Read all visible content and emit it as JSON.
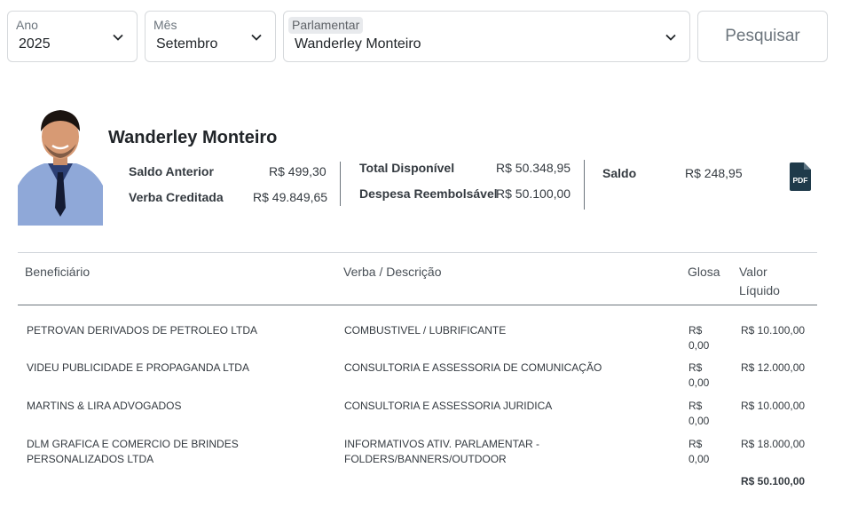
{
  "filters": {
    "ano": {
      "label": "Ano",
      "value": "2025"
    },
    "mes": {
      "label": "Mês",
      "value": "Setembro"
    },
    "parlamentar": {
      "label": "Parlamentar",
      "value": "Wanderley Monteiro"
    },
    "search_label": "Pesquisar"
  },
  "profile": {
    "name": "Wanderley Monteiro",
    "saldo_anterior": {
      "label": "Saldo Anterior",
      "value": "R$ 499,30"
    },
    "verba_creditada": {
      "label": "Verba Creditada",
      "value": "R$ 49.849,65"
    },
    "total_disponivel": {
      "label": "Total Disponível",
      "value": "R$ 50.348,95"
    },
    "despesa_reembolsavel": {
      "label": "Despesa Reembolsável",
      "value": "R$ 50.100,00"
    },
    "saldo": {
      "label": "Saldo",
      "value": "R$ 248,95"
    },
    "pdf_icon": "file-pdf-icon"
  },
  "table": {
    "headers": {
      "beneficiario": "Beneficiário",
      "verba": "Verba / Descrição",
      "glosa": "Glosa",
      "valor": "Valor Líquido"
    },
    "rows": [
      {
        "beneficiario": "PETROVAN DERIVADOS DE PETROLEO LTDA",
        "verba": "COMBUSTIVEL / LUBRIFICANTE",
        "glosa": "R$ 0,00",
        "valor": "R$ 10.100,00"
      },
      {
        "beneficiario": "VIDEU PUBLICIDADE E PROPAGANDA LTDA",
        "verba": "CONSULTORIA E ASSESSORIA DE COMUNICAÇÃO",
        "glosa": "R$ 0,00",
        "valor": "R$ 12.000,00"
      },
      {
        "beneficiario": "MARTINS & LIRA ADVOGADOS",
        "verba": "CONSULTORIA E ASSESSORIA JURIDICA",
        "glosa": "R$ 0,00",
        "valor": "R$ 10.000,00"
      },
      {
        "beneficiario": "DLM GRAFICA E COMERCIO DE BRINDES PERSONALIZADOS LTDA",
        "verba": "INFORMATIVOS ATIV. PARLAMENTAR - FOLDERS/BANNERS/OUTDOOR",
        "glosa": "R$ 0,00",
        "valor": "R$ 18.000,00"
      }
    ],
    "total": "R$ 50.100,00"
  },
  "colors": {
    "text": "#212529",
    "border": "#d6d9dc",
    "pdf": "#1f3a4a",
    "suit": "#8fa8d8"
  }
}
